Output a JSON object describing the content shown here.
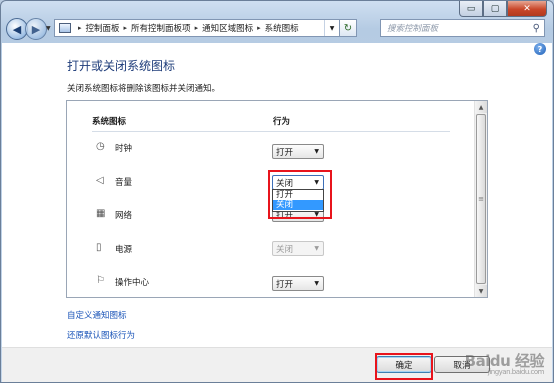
{
  "window": {
    "caption": {
      "minimize": "▭",
      "maximize": "▢",
      "close": "✕"
    }
  },
  "nav": {
    "back": "◀",
    "forward": "▶",
    "history_arrow": "▼",
    "breadcrumbs": [
      "控制面板",
      "所有控制面板项",
      "通知区域图标",
      "系统图标"
    ],
    "crumb_sep": "▸",
    "address_drop": "▼",
    "refresh": "↻",
    "search_placeholder": "搜索控制面板",
    "search_icon": "⚲"
  },
  "page": {
    "help": "?",
    "title": "打开或关闭系统图标",
    "description": "关闭系统图标将删除该图标并关闭通知。",
    "columns": {
      "icon": "系统图标",
      "behavior": "行为"
    },
    "rows": [
      {
        "icon": "clock-icon",
        "glyph": "◷",
        "label": "时钟",
        "value": "打开",
        "state": "normal"
      },
      {
        "icon": "volume-icon",
        "glyph": "◁",
        "label": "音量",
        "value": "关闭",
        "state": "open"
      },
      {
        "icon": "network-icon",
        "glyph": "▦",
        "label": "网络",
        "value": "打开",
        "state": "normal"
      },
      {
        "icon": "power-icon",
        "glyph": "▯",
        "label": "电源",
        "value": "关闭",
        "state": "disabled"
      },
      {
        "icon": "action-center-icon",
        "glyph": "⚐",
        "label": "操作中心",
        "value": "打开",
        "state": "normal"
      }
    ],
    "dropdown_options": [
      "打开",
      "关闭"
    ],
    "dropdown_highlight_index": 1,
    "combo_arrow": "▼",
    "links": {
      "customize": "自定义通知图标",
      "restore": "还原默认图标行为"
    }
  },
  "footer": {
    "ok": "确定",
    "cancel": "取消"
  },
  "watermark": {
    "brand": "Baidu 经验",
    "sub": "jingyan.baidu.com"
  },
  "colors": {
    "highlight_box": "#e8141c",
    "link": "#1a54b8",
    "title": "#1e3c7a",
    "selection": "#3399ff"
  }
}
